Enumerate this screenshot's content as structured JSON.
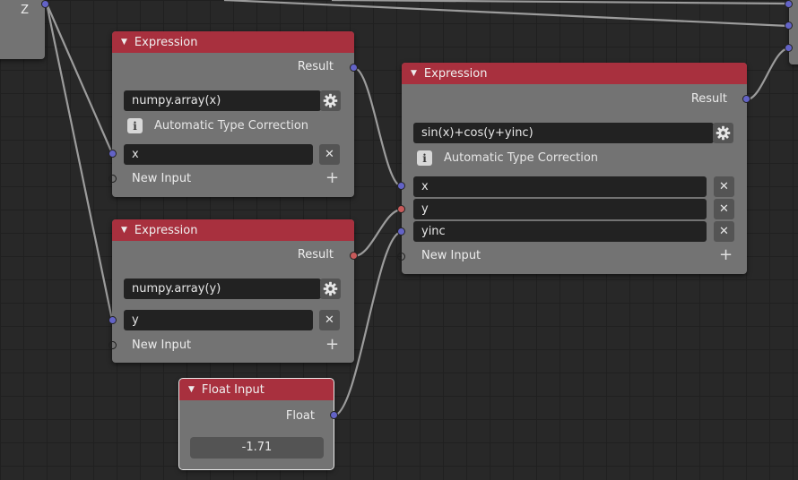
{
  "nodes": {
    "z_node": {
      "socket_label": "Z"
    },
    "expr_x": {
      "title": "Expression",
      "output_label": "Result",
      "expression": "numpy.array(x)",
      "type_correction_label": "Automatic Type Correction",
      "inputs": [
        "x"
      ],
      "new_input_label": "New Input"
    },
    "expr_y": {
      "title": "Expression",
      "output_label": "Result",
      "expression": "numpy.array(y)",
      "inputs": [
        "y"
      ],
      "new_input_label": "New Input"
    },
    "expr_main": {
      "title": "Expression",
      "output_label": "Result",
      "expression": "sin(x)+cos(y+yinc)",
      "type_correction_label": "Automatic Type Correction",
      "inputs": [
        "x",
        "y",
        "yinc"
      ],
      "new_input_label": "New Input"
    },
    "float_input": {
      "title": "Float Input",
      "output_label": "Float",
      "value": "-1.71"
    }
  },
  "colors": {
    "header_red": "#a8303e",
    "node_body": "#737373",
    "socket_blue": "#6363c7",
    "socket_red": "#c75a5a",
    "background": "#282828"
  },
  "icons": {
    "collapse": "triangle-down-icon",
    "settings": "gear-icon",
    "remove": "x-icon",
    "add": "plus-icon",
    "info": "info-icon"
  }
}
